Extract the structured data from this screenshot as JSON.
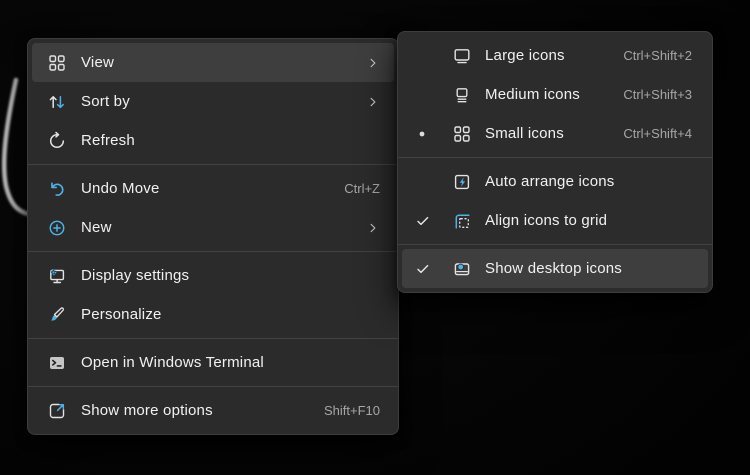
{
  "colors": {
    "accent": "#4fb3e8",
    "menu_background": "#2b2b2b",
    "highlight": "#3e3e3e",
    "text": "#f1f1f1",
    "shortcut_text": "#a6a6a6"
  },
  "context_menu": {
    "items": [
      {
        "label": "View",
        "icon": "view-grid-icon",
        "has_submenu": true,
        "highlighted": true
      },
      {
        "label": "Sort by",
        "icon": "sort-icon",
        "has_submenu": true
      },
      {
        "label": "Refresh",
        "icon": "refresh-icon"
      },
      {
        "type": "separator"
      },
      {
        "label": "Undo Move",
        "icon": "undo-icon",
        "shortcut": "Ctrl+Z"
      },
      {
        "label": "New",
        "icon": "new-icon",
        "has_submenu": true
      },
      {
        "type": "separator"
      },
      {
        "label": "Display settings",
        "icon": "display-settings-icon"
      },
      {
        "label": "Personalize",
        "icon": "personalize-icon"
      },
      {
        "type": "separator"
      },
      {
        "label": "Open in Windows Terminal",
        "icon": "terminal-icon"
      },
      {
        "type": "separator"
      },
      {
        "label": "Show more options",
        "icon": "show-more-icon",
        "shortcut": "Shift+F10"
      }
    ]
  },
  "view_submenu": {
    "items": [
      {
        "label": "Large icons",
        "icon": "large-icons-icon",
        "shortcut": "Ctrl+Shift+2"
      },
      {
        "label": "Medium icons",
        "icon": "medium-icons-icon",
        "shortcut": "Ctrl+Shift+3"
      },
      {
        "label": "Small icons",
        "icon": "small-icons-icon",
        "shortcut": "Ctrl+Shift+4",
        "radio_selected": true
      },
      {
        "type": "separator"
      },
      {
        "label": "Auto arrange icons",
        "icon": "auto-arrange-icon"
      },
      {
        "label": "Align icons to grid",
        "icon": "align-grid-icon",
        "checked": true
      },
      {
        "type": "separator"
      },
      {
        "label": "Show desktop icons",
        "icon": "show-desktop-icon",
        "checked": true,
        "highlighted": true
      }
    ]
  }
}
